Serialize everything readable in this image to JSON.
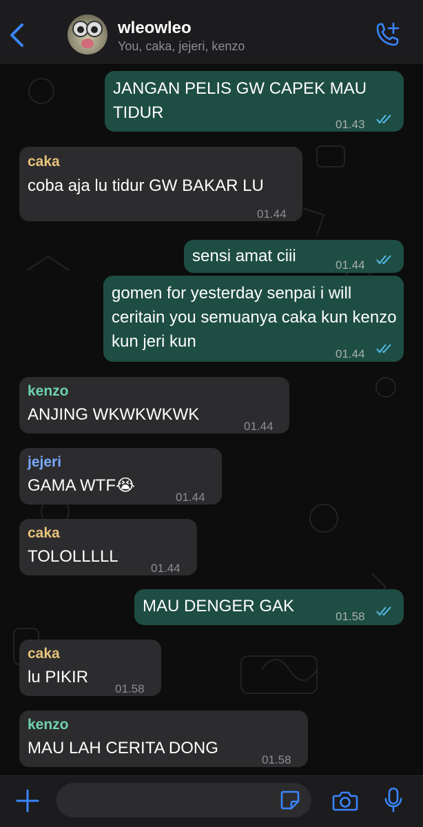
{
  "header": {
    "title": "wleowleo",
    "subtitle": "You, caka, jejeri, kenzo"
  },
  "colors": {
    "accent": "#3a86ff",
    "outgoing_bubble": "#1e4d43",
    "incoming_bubble": "#2c2c2e",
    "read_ticks": "#53bdeb",
    "caka": "#e6c37a",
    "kenzo": "#6fd2ac",
    "jejeri": "#7aa9ff"
  },
  "icons": {
    "back": "chevron-left-icon",
    "add_call": "phone-plus-icon",
    "attach": "plus-icon",
    "sticker": "sticker-icon",
    "camera": "camera-icon",
    "mic": "microphone-icon"
  },
  "messages": [
    {
      "direction": "out",
      "text": "JANGAN PELIS GW CAPEK MAU TIDUR",
      "time": "01.43",
      "read": true
    },
    {
      "direction": "in",
      "sender": "caka",
      "text": "coba aja lu tidur GW BAKAR LU",
      "time": "01.44"
    },
    {
      "direction": "out",
      "text": "sensi amat ciii",
      "time": "01.44",
      "read": true
    },
    {
      "direction": "out",
      "text": "gomen for yesterday senpai i will ceritain you semuanya caka kun kenzo kun jeri kun",
      "time": "01.44",
      "read": true
    },
    {
      "direction": "in",
      "sender": "kenzo",
      "text": "ANJING WKWKWKWK",
      "time": "01.44"
    },
    {
      "direction": "in",
      "sender": "jejeri",
      "text": "GAMA WTF😭",
      "time": "01.44"
    },
    {
      "direction": "in",
      "sender": "caka",
      "text": "TOLOLLLLL",
      "time": "01.44"
    },
    {
      "direction": "out",
      "text": "MAU DENGER GAK",
      "time": "01.58",
      "read": true
    },
    {
      "direction": "in",
      "sender": "caka",
      "text": "lu PIKIR",
      "time": "01.58"
    },
    {
      "direction": "in",
      "sender": "kenzo",
      "text": "MAU LAH CERITA DONG",
      "time": "01.58"
    }
  ]
}
